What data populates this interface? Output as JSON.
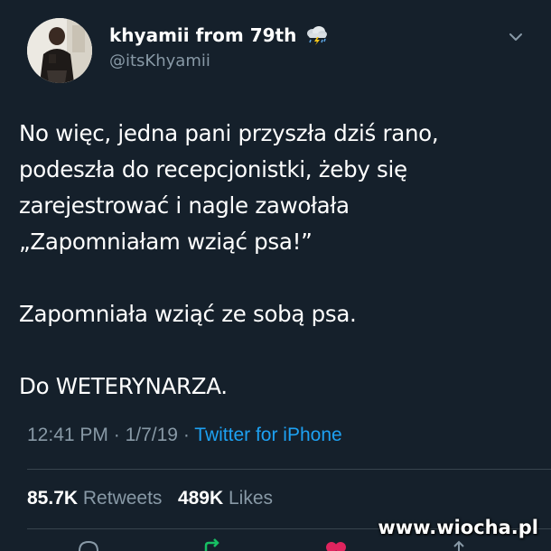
{
  "tweet": {
    "author": {
      "display_name": "khyamii from 79th",
      "handle": "@itsKhyamii",
      "badge_icon": "cloud-rain-lightning-icon"
    },
    "text_paragraphs": [
      [
        "No więc, jedna pani przyszła dziś rano,",
        "podeszła do recepcjonistki, żeby się",
        "zarejestrować i nagle zawołała",
        "„Zapomniałam wziąć psa!”"
      ],
      [
        "Zapomniała wziąć ze sobą psa."
      ],
      [
        "Do WETERYNARZA."
      ]
    ],
    "meta": {
      "time": "12:41 PM",
      "separator": "·",
      "date": "1/7/19",
      "source": "Twitter for iPhone"
    },
    "stats": {
      "retweets_count": "85.7K",
      "retweets_label": "Retweets",
      "likes_count": "489K",
      "likes_label": "Likes"
    },
    "actions": [
      "reply-icon",
      "retweet-icon",
      "like-icon",
      "share-icon"
    ]
  },
  "watermark": "www.wiocha.pl",
  "colors": {
    "background": "#15202b",
    "text": "#ffffff",
    "secondary_text": "#8899a6",
    "link": "#1da1f2",
    "divider": "#38444d",
    "retweet": "#17bf63",
    "like": "#e0245e"
  }
}
